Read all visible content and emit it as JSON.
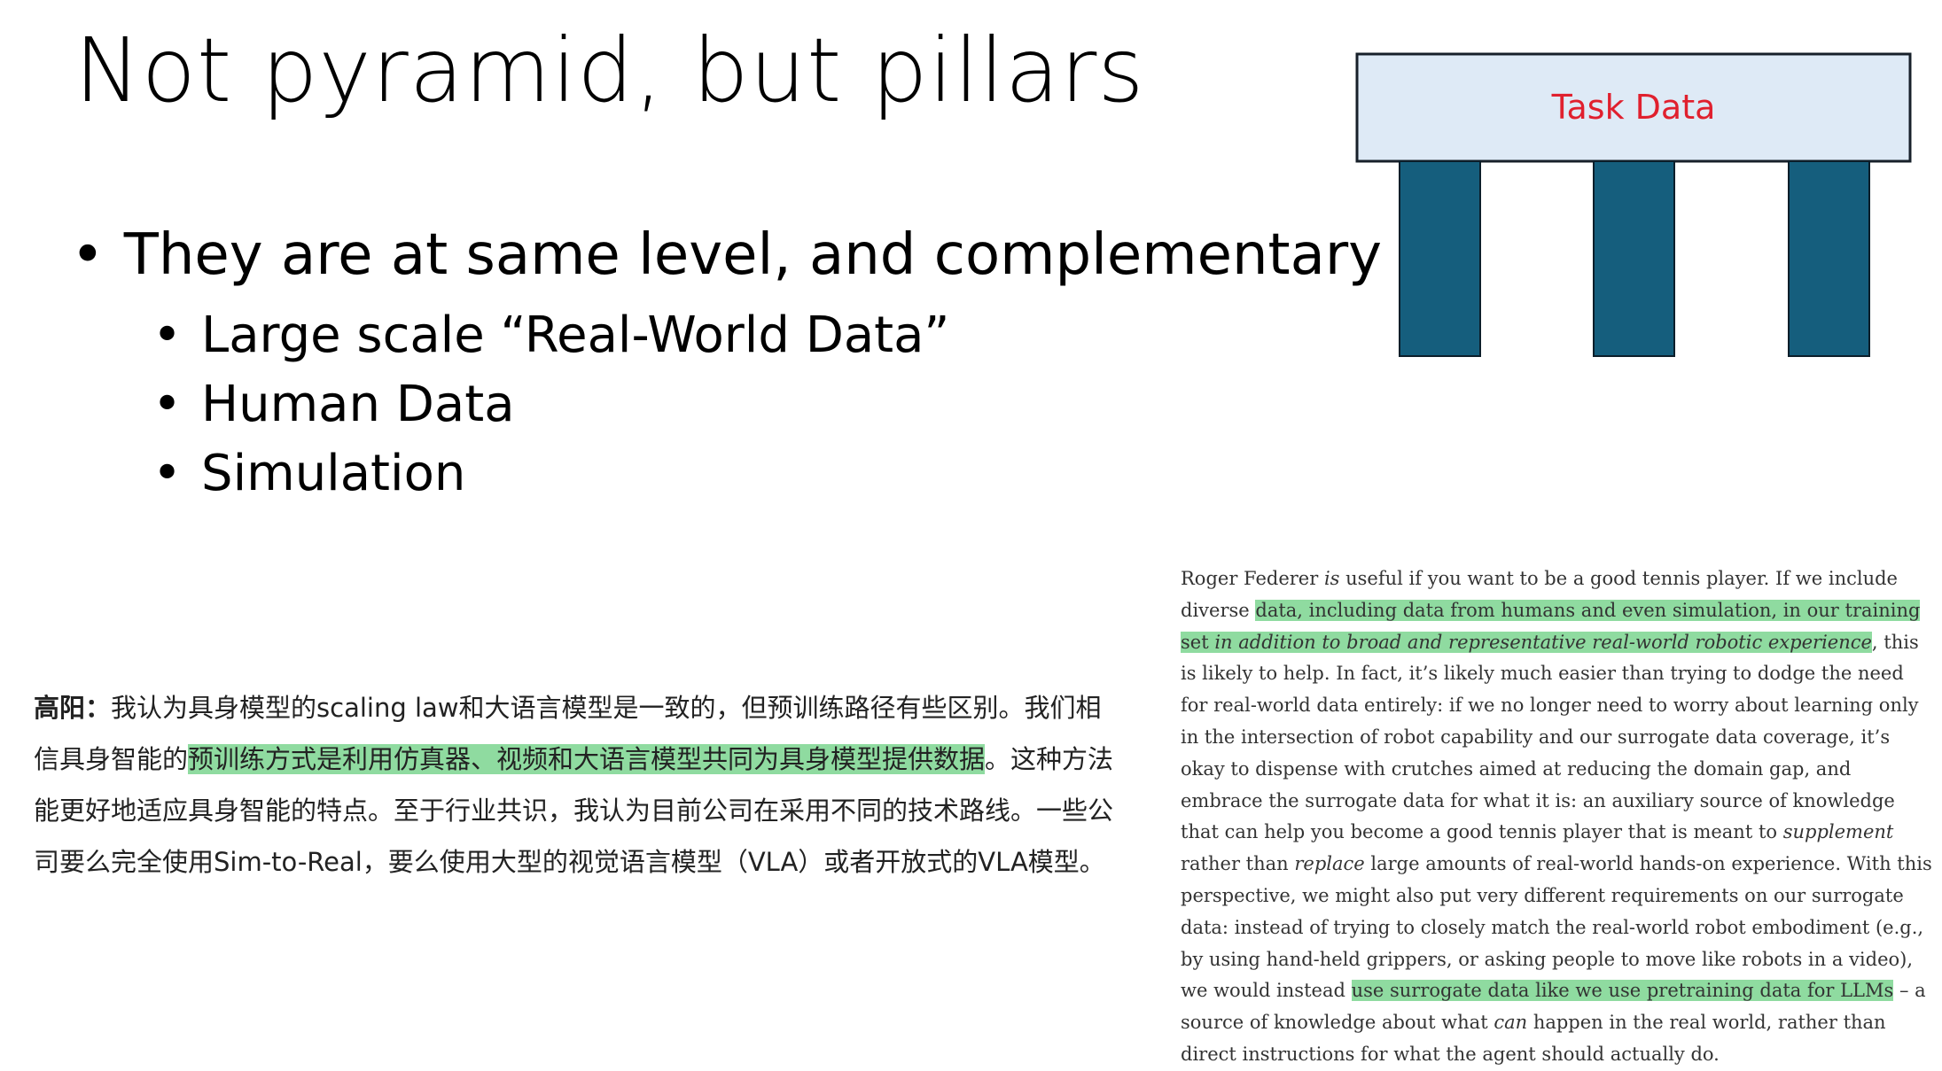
{
  "title": "Not pyramid, but pillars",
  "bullets": {
    "main": "They are at same level, and complementary",
    "subs": [
      "Large scale “Real-World Data”",
      "Human Data",
      "Simulation"
    ]
  },
  "diagram": {
    "top_label": "Task Data",
    "colors": {
      "slab_fill": "#deeaf6",
      "slab_stroke": "#17202a",
      "label": "#e0202e",
      "pillar_fill": "#155e7d",
      "pillar_stroke": "#0c1e2a"
    }
  },
  "cn_quote": {
    "speaker": "高阳：",
    "part1": "我认为具身模型的scaling law和大语言模型是一致的，但预训练路径有些区别。我们相信具身智能的",
    "highlight": "预训练方式是利用仿真器、视频和大语言模型共同为具身模型提供数据",
    "part2": "。这种方法能更好地适应具身智能的特点。至于行业共识，我认为目前公司在采用不同的技术路线。一些公司要么完全使用Sim-to-Real，要么使用大型的视觉语言模型（VLA）或者开放式的VLA模型。"
  },
  "en_excerpt": {
    "t1": "Roger Federer ",
    "t1_em": "is",
    "t2": " useful if you want to be a good tennis player. If we include diverse ",
    "hl1": "data, including data from humans and even simulation, in our training set ",
    "hl1_em": "in addition to broad and representative real-world robotic experience",
    "t3": ", this is likely to help. In fact, it’s likely much easier than trying to dodge the need for real-world data entirely: if we no longer need to worry about learning only in the intersection of robot capability and our surrogate data coverage, it’s okay to dispense with crutches aimed at reducing the domain gap, and embrace the surrogate data for what it is: an auxiliary source of knowledge that can help you become a good tennis player that is meant to ",
    "t3_em": "supplement",
    "t4": " rather than ",
    "t4_em": "replace",
    "t5": " large amounts of real-world hands-on experience. With this perspective, we might also put very different requirements on our surrogate data: instead of trying to closely match the real-world robot embodiment (e.g., by using hand-held grippers, or asking people to move like robots in a video), we would instead ",
    "hl2": "use surrogate data like we use pretraining data for LLMs",
    "t6": " – a source of knowledge about what ",
    "t6_em": "can",
    "t7": " happen in the real world, rather than direct instructions for what the agent should actually do."
  }
}
